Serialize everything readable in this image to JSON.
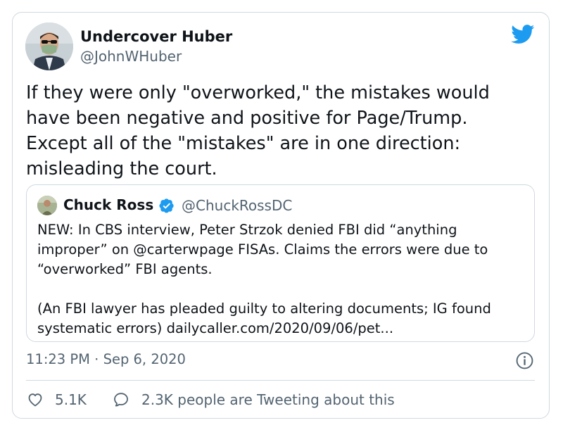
{
  "tweet": {
    "author_name": "Undercover Huber",
    "author_handle": "@JohnWHuber",
    "text": "If they were only \"overworked,\" the mistakes would have been negative and positive for Page/Trump. Except all of the \"mistakes\" are in one direction: misleading the court.",
    "timestamp": "11:23 PM · Sep 6, 2020"
  },
  "quote": {
    "author_name": "Chuck Ross",
    "author_handle": "@ChuckRossDC",
    "paragraph1": "NEW: In CBS interview, Peter Strzok denied FBI did “anything improper” on @carterwpage FISAs. Claims the errors were due to “overworked” FBI agents.",
    "paragraph2": "(An FBI lawyer has pleaded guilty to altering documents; IG found systematic errors) dailycaller.com/2020/09/06/pet..."
  },
  "actions": {
    "like_count": "5.1K",
    "tweeting_text": "2.3K people are Tweeting about this"
  },
  "icons": {
    "brand": "twitter-bird-icon",
    "verified": "verified-badge-icon",
    "info": "info-icon",
    "like": "heart-icon",
    "reply": "speech-bubble-icon"
  },
  "colors": {
    "twitter_blue": "#1d9bf0",
    "text": "#0f1419",
    "secondary": "#536471",
    "border": "#cfd9de"
  }
}
